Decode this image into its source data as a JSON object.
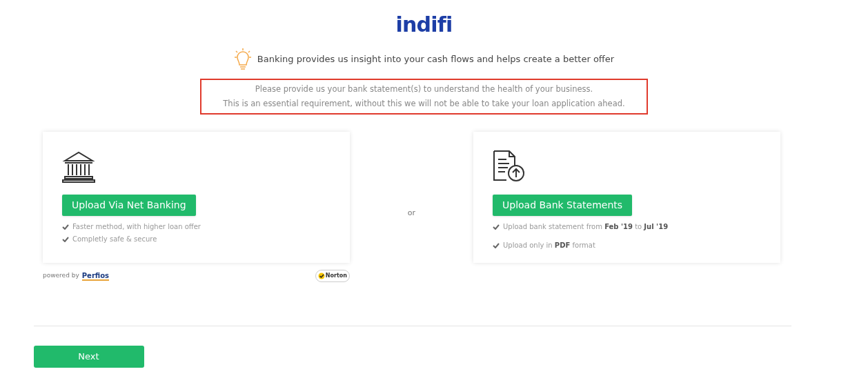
{
  "logo": "indifi",
  "tip": "Banking provides us insight into your cash flows and helps create a better offer",
  "notice": [
    "Please provide us your bank statement(s) to understand the health of your business.",
    "This is an essential requirement, without this we will not be able to take your loan application ahead."
  ],
  "options": [
    {
      "kind": "bank",
      "button": "Upload Via Net Banking",
      "points": [
        "Faster method, with higher loan offer",
        "Completly safe & secure"
      ]
    },
    {
      "kind": "document",
      "button": "Upload Bank Statements",
      "points": [
        "Upload bank statement from **Feb '19** to **Jul '19**",
        "Upload only in **PDF** format"
      ]
    }
  ],
  "separator": "or",
  "powered_by": {
    "label": "powered by",
    "brand": "Perfios",
    "seal": "Norton"
  },
  "next_button": "Next"
}
